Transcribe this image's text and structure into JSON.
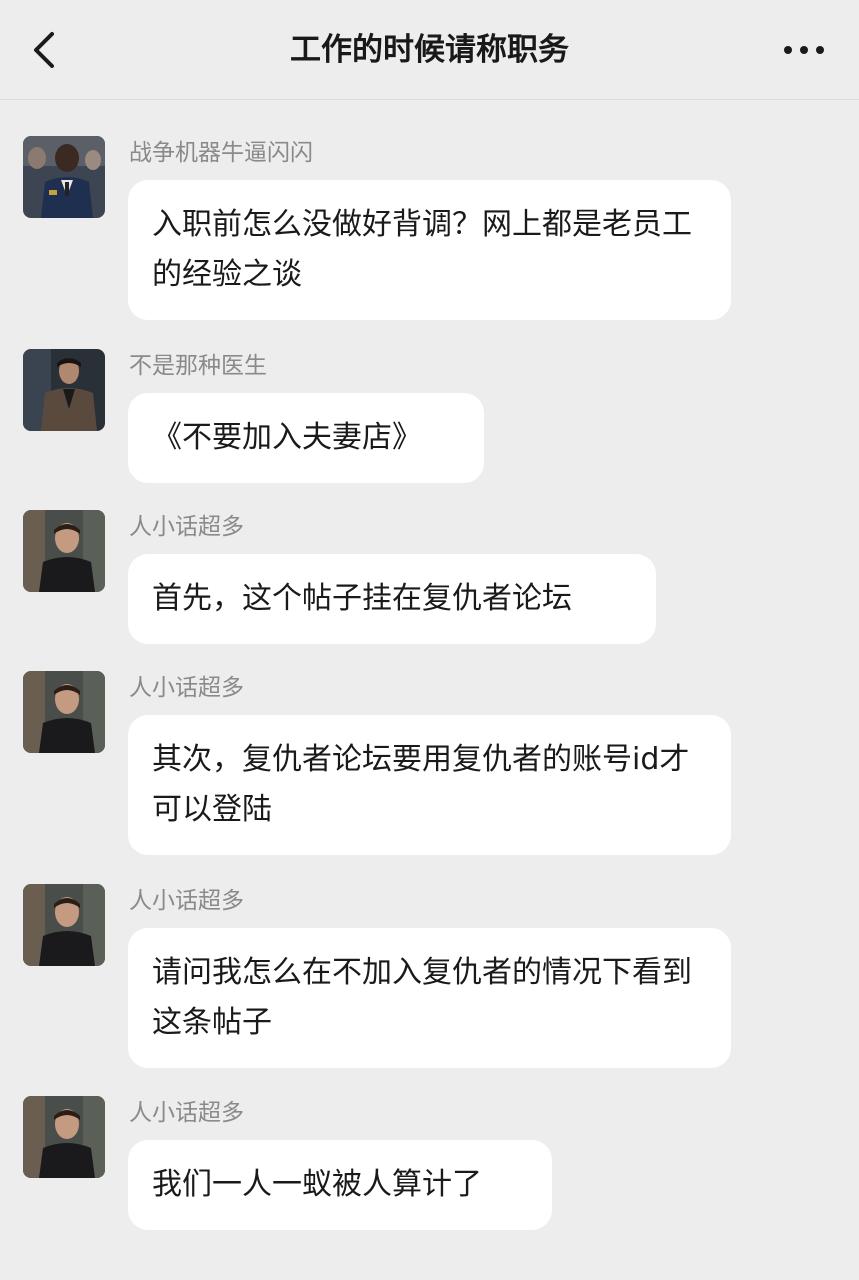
{
  "header": {
    "title": "工作的时候请称职务",
    "back_icon": "chevron-left-icon",
    "more_icon": "more-dots-icon"
  },
  "messages": [
    {
      "sender": "战争机器牛逼闪闪",
      "text": "入职前怎么没做好背调？网上都是老员工的经验之谈",
      "avatar": "avatar-war-machine"
    },
    {
      "sender": "不是那种医生",
      "text": "《不要加入夫妻店》",
      "avatar": "avatar-doctor"
    },
    {
      "sender": "人小话超多",
      "text": "首先，这个帖子挂在复仇者论坛",
      "avatar": "avatar-ant-man"
    },
    {
      "sender": "人小话超多",
      "text": "其次，复仇者论坛要用复仇者的账号id才可以登陆",
      "avatar": "avatar-ant-man"
    },
    {
      "sender": "人小话超多",
      "text": "请问我怎么在不加入复仇者的情况下看到这条帖子",
      "avatar": "avatar-ant-man"
    },
    {
      "sender": "人小话超多",
      "text": "我们一人一蚁被人算计了",
      "avatar": "avatar-ant-man"
    }
  ]
}
